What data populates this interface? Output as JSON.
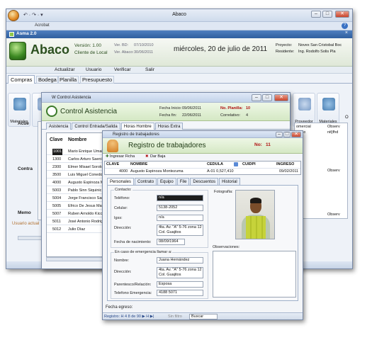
{
  "app": {
    "title": "Abaco",
    "appname": "Acrobat",
    "doc_tab": "Asma 2.0"
  },
  "header": {
    "logo": "Abaco",
    "version": "Versión: 1.00",
    "client": "Cliente de Local",
    "ver_bd": "Ver. BD:",
    "ver_bd_val": "07/10/2010",
    "ver_abaco": "Ver. Abaco:",
    "ver_abaco_val": "30/06/2011",
    "date": "miércoles, 20 de julio de 2011",
    "proyecto_lbl": "Proyecto:",
    "proyecto_val": "Novex San Cristobal  Boc",
    "residente_lbl": "Residente:",
    "residente_val": "Ing. Rodolfo Solis   Pla"
  },
  "menu": [
    "Actualizar",
    "Usuario",
    "Verificar",
    "Salir"
  ],
  "tabs": [
    "Compras",
    "Bodega",
    "Planilla",
    "Presupuesto"
  ],
  "ribbon": {
    "materiales": "Materiales",
    "proveedor": "Proveedor",
    "materiales2": "Materiales",
    "letter_o": "O"
  },
  "left": {
    "acue": "Acue",
    "contra": "Contra",
    "memo": "Memo",
    "usuario": "Usuario actual"
  },
  "right_panel": {
    "col1": "omercial",
    "col2": "Observ",
    "r1c1": "resso",
    "r1c2": "nit}fhd",
    "r2c1": "al",
    "r2c2": "Observ",
    "r3c1": "al",
    "r3c2": "Observ"
  },
  "asistencia": {
    "wtitle": "W Control Asistencia",
    "title": "Control Asistencia",
    "fecha_inicio_lbl": "Fecha Inicio:",
    "fecha_inicio": "09/06/2011",
    "fecha_fin_lbl": "Fecha fin:",
    "fecha_fin": "22/06/2011",
    "planilla_lbl": "No. Planilla:",
    "planilla": "10",
    "correlativo_lbl": "Correlativo:",
    "correlativo": "4",
    "tabs": [
      "Asistencia",
      "Control Entrada/Salida",
      "Horas Hombre",
      "Horas Extra"
    ],
    "col_clave": "Clave",
    "col_nombre": "Nombre",
    "rows": [
      [
        "1001",
        "Mario Enrique Umai"
      ],
      [
        "1300",
        "Carlos Arturo Saeni"
      ],
      [
        "2300",
        "Elmer Misael Sorolo"
      ],
      [
        "3500",
        "Luis Miguel Conedo"
      ],
      [
        "4000",
        "Augusto Espinoza M"
      ],
      [
        "5003",
        "Pablo Sinn Siquinic"
      ],
      [
        "5004",
        "Jorge Francisco San"
      ],
      [
        "5005",
        "Efrico De Jesus Mati"
      ],
      [
        "5007",
        "Ruben Arnoldo Kicc"
      ],
      [
        "5011",
        "José Antonio Rodrig"
      ],
      [
        "5012",
        "Julio Díaz"
      ]
    ]
  },
  "registro": {
    "wtitle": "Registro de trabajadores",
    "title": "Registro de trabajadores",
    "no_lbl": "No:",
    "no": "11",
    "ingresar": "Ingresar Ficha",
    "dar_baja": "Dar Baja",
    "cols": [
      "CLAVE",
      "NOMBRE",
      "CEDULA",
      "CUIDPI",
      "INGRESO"
    ],
    "row": [
      "4000",
      "Augusto Espinoza Montezuma",
      "A-01 0,527,410",
      "",
      "09/02/2011"
    ],
    "tabs": [
      "Personales",
      "Contrato",
      "Equipo",
      "File",
      "Descuentos",
      "Historial"
    ],
    "contacto": "Contacto:",
    "fotografia": "Fotografía:",
    "observaciones": "Observaciones:",
    "telefono_lbl": "Teléfono:",
    "telefono": "n/a",
    "celular_lbl": "Celular:",
    "celular": "5138-2052",
    "lgss_lbl": "Igss:",
    "lgss": "n/a",
    "direccion_lbl": "Dirección:",
    "direccion": "4ta. Av. \"A\" 5-76 zona 12 Col. Guajitos",
    "nacimiento_lbl": "Fecha de nacimiento:",
    "nacimiento": "08/09/1964",
    "emergencia": "En caso de emergencia llamar a:",
    "e_nombre_lbl": "Nombre:",
    "e_nombre": "Juana Hernández",
    "e_dir_lbl": "Dirección:",
    "e_dir": "4ta. Av. \"A\" 5-76 zona 12 Col. Guajitos",
    "e_par_lbl": "Parentesco/Relación:",
    "e_par": "Esposa",
    "e_tel_lbl": "Telefono Emergencia:",
    "e_tel": "4188 5071",
    "egreso_lbl": "Fecha egreso:",
    "nav": "Registro: H  4  8 de 90  ▶ H ▶|",
    "sin_filtro": "Sin filtro",
    "buscar": "Buscar"
  }
}
